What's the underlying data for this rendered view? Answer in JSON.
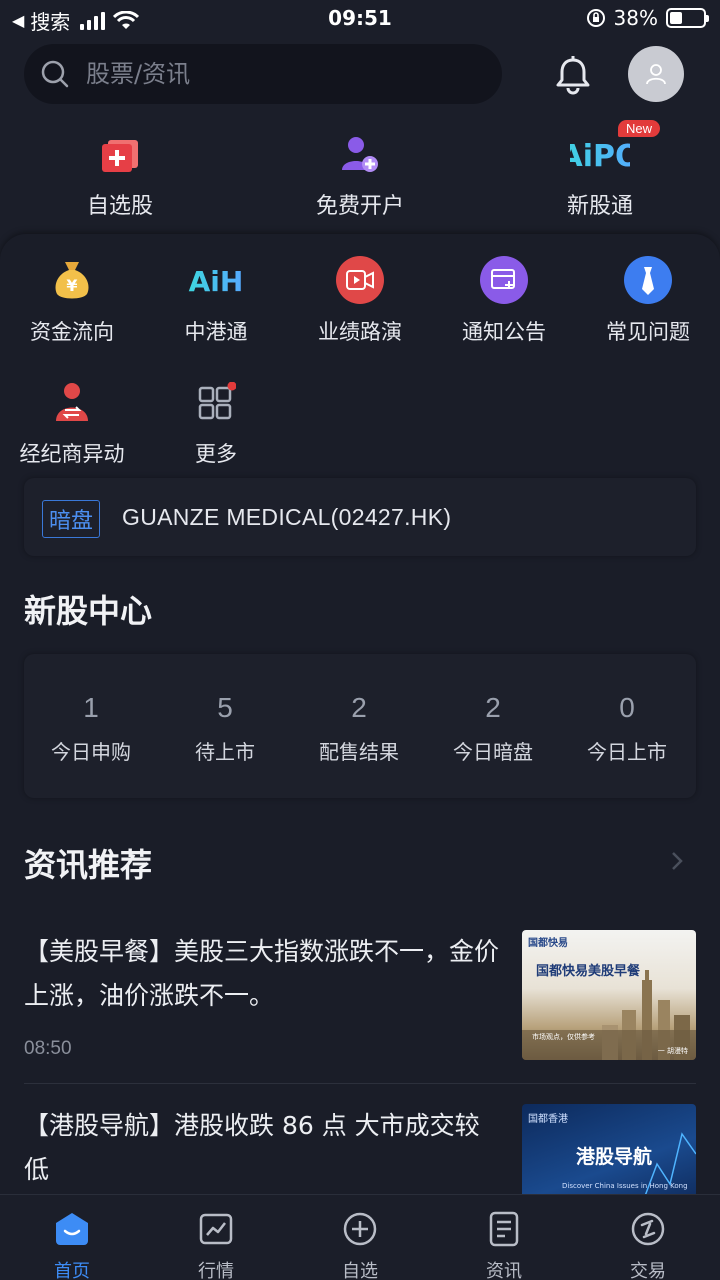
{
  "status_bar": {
    "back_label": "搜索",
    "time": "09:51",
    "battery": "38%"
  },
  "search": {
    "placeholder": "股票/资讯"
  },
  "top_features": [
    {
      "label": "自选股",
      "icon": "watchlist-plus-icon"
    },
    {
      "label": "免费开户",
      "icon": "open-account-icon"
    },
    {
      "label": "新股通",
      "icon": "aipo-logo-icon",
      "badge": "New",
      "logo_text": "AiPO"
    }
  ],
  "grid": [
    {
      "label": "资金流向",
      "icon": "money-bag-icon"
    },
    {
      "label": "中港通",
      "icon": "aih-logo-icon",
      "logo_text": "AiH"
    },
    {
      "label": "业绩路演",
      "icon": "video-camera-icon"
    },
    {
      "label": "通知公告",
      "icon": "announcement-icon"
    },
    {
      "label": "常见问题",
      "icon": "tie-icon"
    },
    {
      "label": "经纪商异动",
      "icon": "broker-exchange-icon"
    },
    {
      "label": "更多",
      "icon": "more-grid-icon"
    }
  ],
  "dark_pool": {
    "tag": "暗盘",
    "text": "GUANZE MEDICAL(02427.HK)"
  },
  "ipo_center": {
    "title": "新股中心",
    "stats": [
      {
        "value": "1",
        "label": "今日申购"
      },
      {
        "value": "5",
        "label": "待上市"
      },
      {
        "value": "2",
        "label": "配售结果"
      },
      {
        "value": "2",
        "label": "今日暗盘"
      },
      {
        "value": "0",
        "label": "今日上市"
      }
    ]
  },
  "news": {
    "title": "资讯推荐",
    "items": [
      {
        "title": "【美股早餐】美股三大指数涨跌不一，金价上涨，油价涨跌不一。",
        "time": "08:50",
        "thumb_brand": "国都快易",
        "thumb_title": "国都快易美股早餐",
        "thumb_caption": "市场观点，仅供参考",
        "thumb_signature": "一 胡漫特"
      },
      {
        "title": "【港股导航】港股收跌 86 点 大市成交较低",
        "time": "",
        "thumb_brand": "国都香港",
        "thumb_title": "港股导航",
        "thumb_caption": "Discover China Issues in Hong Kong"
      }
    ]
  },
  "tabs": [
    {
      "label": "首页",
      "icon": "home-icon",
      "active": true
    },
    {
      "label": "行情",
      "icon": "market-chart-icon"
    },
    {
      "label": "自选",
      "icon": "add-circle-icon"
    },
    {
      "label": "资讯",
      "icon": "news-doc-icon"
    },
    {
      "label": "交易",
      "icon": "trade-icon"
    }
  ],
  "colors": {
    "accent": "#3d8cf5",
    "background": "#1b1e29",
    "badge": "#e23b3b"
  }
}
